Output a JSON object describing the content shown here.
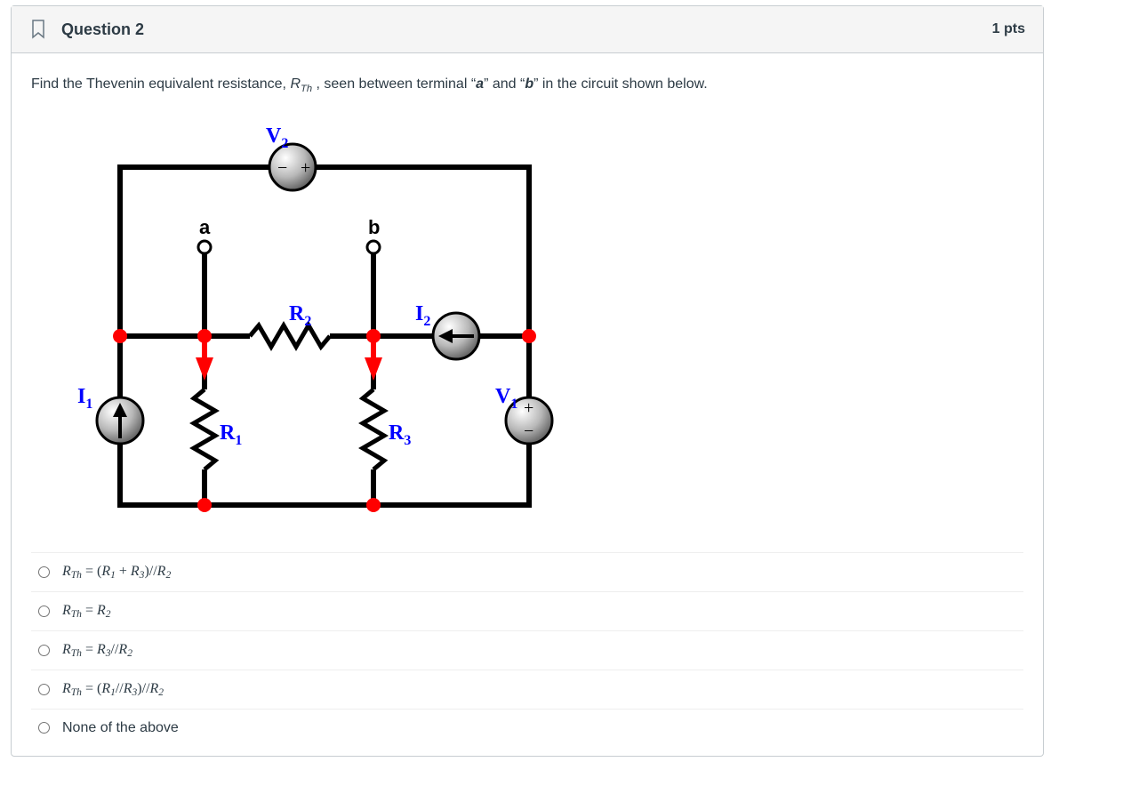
{
  "question": {
    "title": "Question 2",
    "points": "1 pts",
    "prompt_pre": "Find the Thevenin equivalent resistance, ",
    "prompt_var": "R",
    "prompt_var_sub": "Th",
    "prompt_mid": " , seen between terminal “",
    "term_a": "a",
    "prompt_between": "” and “",
    "term_b": "b",
    "prompt_post": "” in the circuit shown below."
  },
  "circuit": {
    "V2": "V",
    "V2s": "2",
    "V1": "V",
    "V1s": "1",
    "I1": "I",
    "I1s": "1",
    "I2": "I",
    "I2s": "2",
    "R1": "R",
    "R1s": "1",
    "R2": "R",
    "R2s": "2",
    "R3": "R",
    "R3s": "3",
    "a": "a",
    "b": "b"
  },
  "options": {
    "lhs": "R",
    "lhs_sub": "Th",
    "eq": " = ",
    "o1_a": "(",
    "o1_b": "R",
    "o1_bs": "1",
    "o1_c": " + ",
    "o1_d": "R",
    "o1_ds": "3",
    "o1_e": ")//",
    "o1_f": "R",
    "o1_fs": "2",
    "o2_a": "R",
    "o2_as": "2",
    "o3_a": "R",
    "o3_as": "3",
    "o3_b": "//",
    "o3_c": "R",
    "o3_cs": "2",
    "o4_a": "(",
    "o4_b": "R",
    "o4_bs": "1",
    "o4_c": "//",
    "o4_d": "R",
    "o4_ds": "3",
    "o4_e": ")//",
    "o4_f": "R",
    "o4_fs": "2",
    "o5": "None of the above"
  }
}
